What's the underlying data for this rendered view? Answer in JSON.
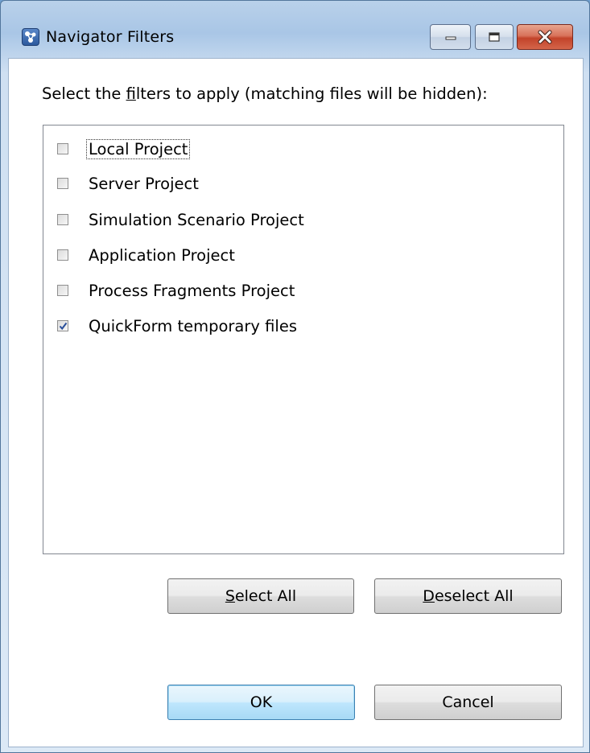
{
  "window": {
    "title": "Navigator Filters",
    "controls": {
      "minimize": "minimize-icon",
      "maximize": "maximize-icon",
      "close": "close-icon"
    }
  },
  "instruction": {
    "before": "Select the ",
    "mnemonic": "f",
    "after": "ilters to apply (matching files will be hidden):"
  },
  "filters": [
    {
      "label": "Local Project",
      "checked": false,
      "focused": true
    },
    {
      "label": "Server Project",
      "checked": false
    },
    {
      "label": "Simulation Scenario Project",
      "checked": false
    },
    {
      "label": "Application Project",
      "checked": false
    },
    {
      "label": "Process Fragments Project",
      "checked": false
    },
    {
      "label": "QuickForm temporary files",
      "checked": true
    }
  ],
  "buttons": {
    "select_all": {
      "mnemonic": "S",
      "rest": "elect All"
    },
    "deselect_all": {
      "mnemonic": "D",
      "rest": "eselect All"
    },
    "ok": "OK",
    "cancel": "Cancel"
  },
  "colors": {
    "close_button": "#c2432a",
    "default_button_border": "#3c7fb1",
    "check_mark": "#2a4f9a"
  }
}
